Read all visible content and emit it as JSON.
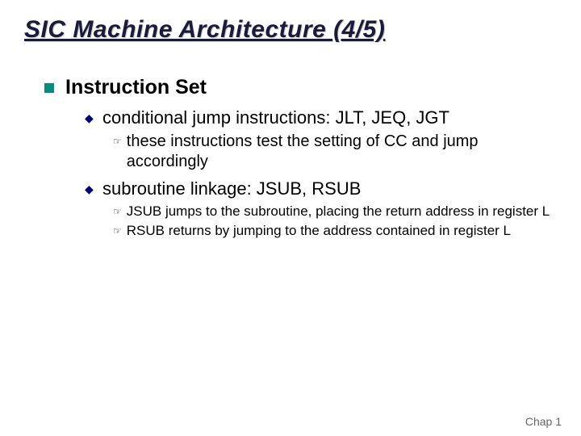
{
  "title": "SIC Machine Architecture (4/5)",
  "lvl1": {
    "label": "Instruction Set"
  },
  "lvl2a": {
    "label": "conditional jump instructions: JLT, JEQ, JGT"
  },
  "lvl3a1": {
    "label": "these instructions test the setting of CC and jump accordingly"
  },
  "lvl2b": {
    "label": "subroutine linkage: JSUB, RSUB"
  },
  "lvl3b1": {
    "label": "JSUB jumps to the subroutine, placing the return address in register L"
  },
  "lvl3b2": {
    "label": "RSUB returns by jumping to the address contained in register L"
  },
  "footer": "Chap 1",
  "colors": {
    "title_navy": "#1a1a3a",
    "bullet_teal": "#0a8a7a",
    "bullet_navy": "#000080"
  }
}
